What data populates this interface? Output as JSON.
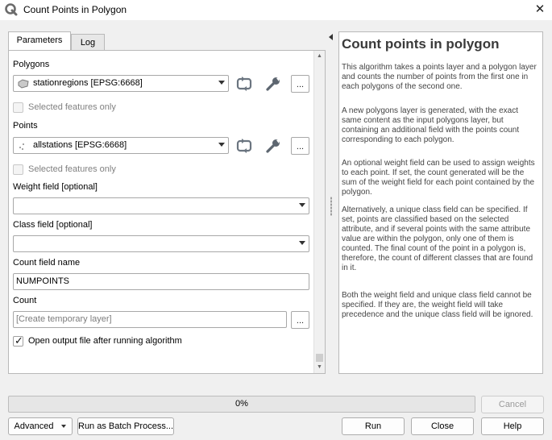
{
  "window": {
    "title": "Count Points in Polygon",
    "app_icon": "qgis-icon",
    "close_icon": "close-icon",
    "close_glyph": "✕"
  },
  "tabs": [
    {
      "label": "Parameters",
      "active": true
    },
    {
      "label": "Log",
      "active": false
    }
  ],
  "params": {
    "polygons": {
      "label": "Polygons",
      "value": "stationregions [EPSG:6668]",
      "layer_icon": "polygon-layer-icon",
      "selected_only_label": "Selected features only",
      "selected_only_checked": false
    },
    "points": {
      "label": "Points",
      "value": "allstations [EPSG:6668]",
      "layer_icon": "point-layer-icon",
      "selected_only_label": "Selected features only",
      "selected_only_checked": false
    },
    "weight": {
      "label": "Weight field [optional]",
      "value": ""
    },
    "class": {
      "label": "Class field [optional]",
      "value": ""
    },
    "count_field": {
      "label": "Count field name",
      "value": "NUMPOINTS"
    },
    "count": {
      "label": "Count",
      "placeholder": "[Create temporary layer]"
    },
    "open_output": {
      "label": "Open output file after running algorithm",
      "checked": true
    },
    "dots_label": "...",
    "iterate_icon": "iterate-icon",
    "settings_icon": "wrench-icon"
  },
  "help": {
    "title": "Count points in polygon",
    "paragraphs": [
      "This algorithm takes a points layer and a polygon layer and counts the number of points from the first one in each polygons of the second one.",
      "A new polygons layer is generated, with the exact same content as the input polygons layer, but containing an additional field with the points count corresponding to each polygon.",
      "An optional weight field can be used to assign weights to each point. If set, the count generated will be the sum of the weight field for each point contained by the polygon.",
      "Alternatively, a unique class field can be specified. If set, points are classified based on the selected attribute, and if several points with the same attribute value are within the polygon, only one of them is counted. The final count of the point in a polygon is, therefore, the count of different classes that are found in it.",
      "Both the weight field and unique class field cannot be specified. If they are, the weight field will take precedence and the unique class field will be ignored."
    ]
  },
  "progress": {
    "text": "0%",
    "value": 0
  },
  "buttons": {
    "cancel": "Cancel",
    "advanced": "Advanced",
    "batch": "Run as Batch Process...",
    "run": "Run",
    "close": "Close",
    "help": "Help"
  },
  "colors": {
    "progress_fill": "#06b025",
    "help_title": "#3a3a3a"
  }
}
